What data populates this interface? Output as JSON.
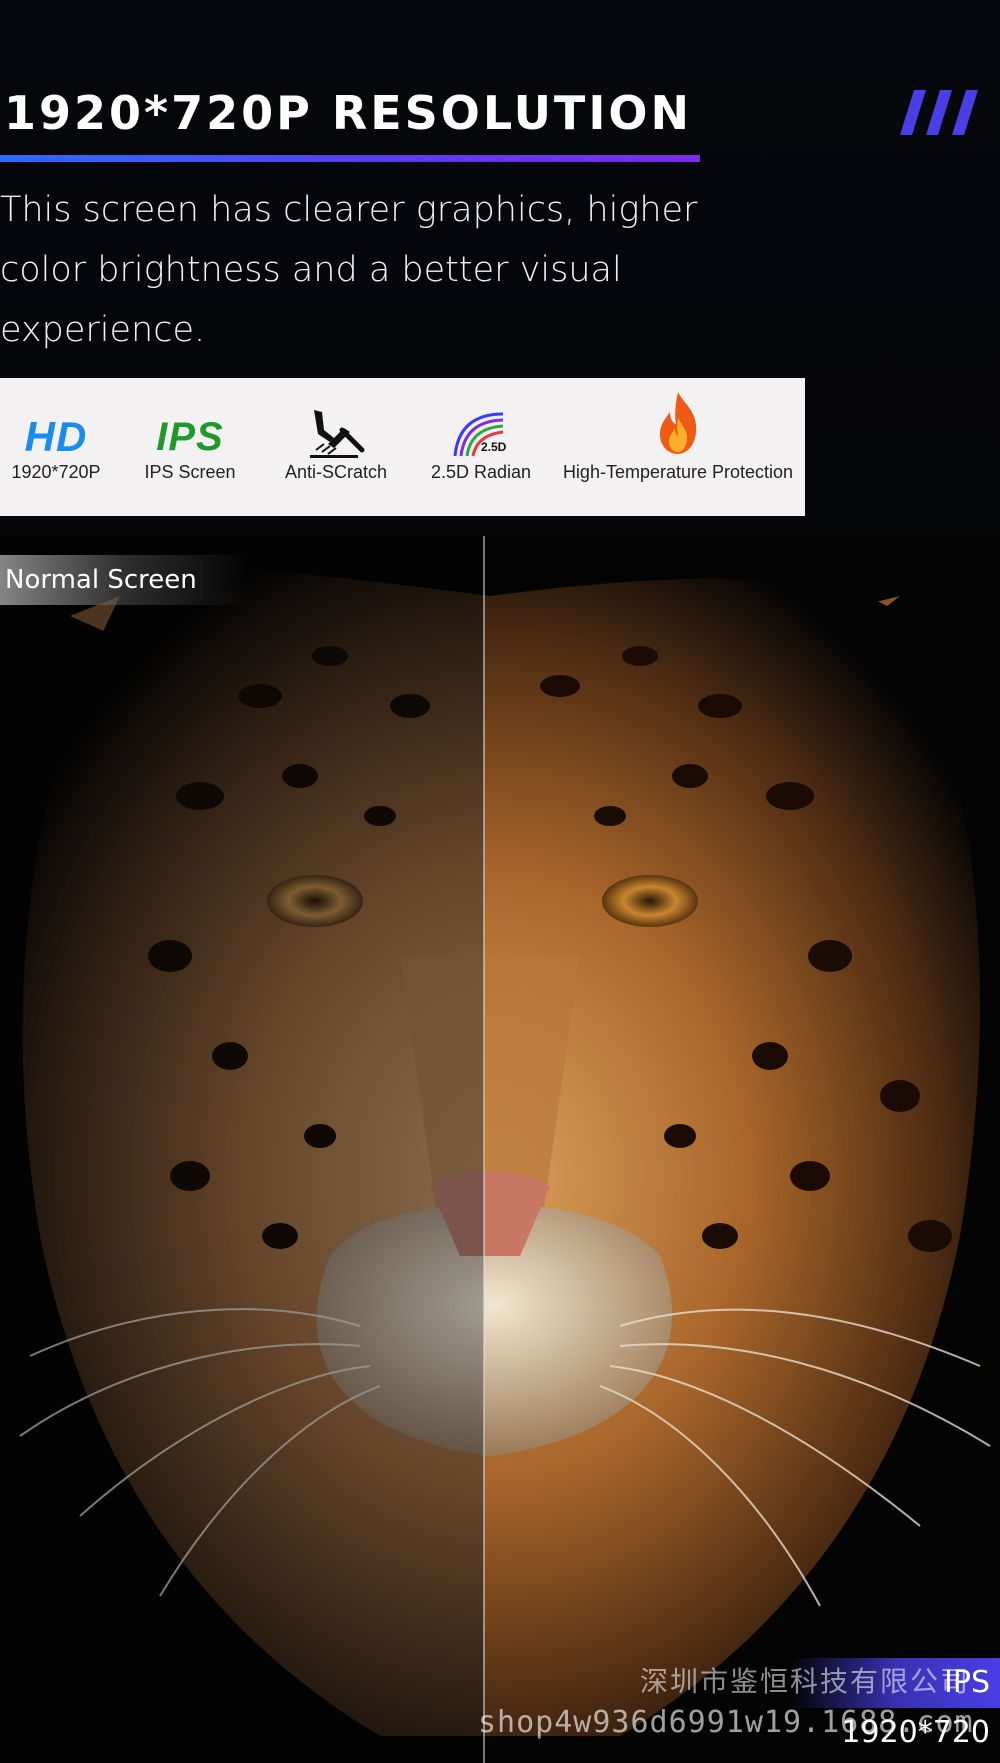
{
  "header": {
    "title": "1920*720P RESOLUTION",
    "description": "This screen has clearer graphics, higher color brightness and a better visual experience.",
    "accent_colors": [
      "#2a6cff",
      "#7b2ce8"
    ],
    "decoration_icon": "triple-slash-icon"
  },
  "features": [
    {
      "icon": "hd-logo-icon",
      "icon_text": "HD",
      "label": "1920*720P",
      "color": "#1a8cf0"
    },
    {
      "icon": "ips-logo-icon",
      "icon_text": "IPS",
      "label": "IPS Screen",
      "color": "#1f9a2a"
    },
    {
      "icon": "hammer-scratch-icon",
      "label": "Anti-SCratch"
    },
    {
      "icon": "curved-edge-icon",
      "icon_text": "2.5D",
      "label": "2.5D Radian"
    },
    {
      "icon": "flame-icon",
      "label": "High-Temperature Protection",
      "color": "#f05a14"
    }
  ],
  "comparison": {
    "left_label": "Normal Screen",
    "right_label": "IPS 1920*720",
    "subject": "leopard-face-illustration"
  },
  "watermark": {
    "company": "深圳市鉴恒科技有限公司",
    "url": "shop4w936d6991w19.1688.com"
  }
}
